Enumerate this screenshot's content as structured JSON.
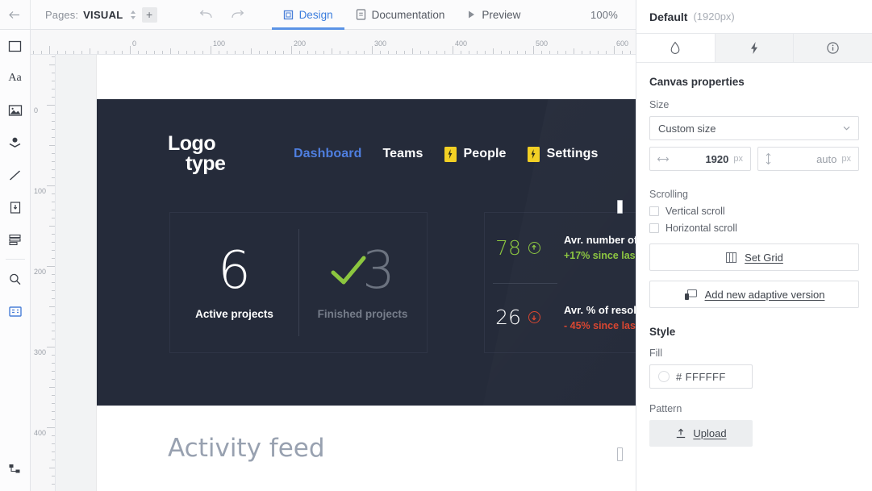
{
  "topbar": {
    "back_icon": "arrow-left-icon",
    "pages_label": "Pages:",
    "pages_value": "VISUAL",
    "add_page_label": "+",
    "undo_icon": "undo-icon",
    "redo_icon": "redo-icon",
    "tabs": [
      {
        "label": "Design",
        "icon": "design-frame-icon",
        "active": true
      },
      {
        "label": "Documentation",
        "icon": "document-icon",
        "active": false
      },
      {
        "label": "Preview",
        "icon": "play-icon",
        "active": false
      }
    ],
    "zoom_level": "100%"
  },
  "left_toolbar": {
    "items": [
      {
        "icon": "rectangle-icon",
        "name": "tool-rectangle"
      },
      {
        "icon": "text-icon",
        "name": "tool-text"
      },
      {
        "icon": "image-icon",
        "name": "tool-image"
      },
      {
        "icon": "layers-icon",
        "name": "tool-layers"
      },
      {
        "icon": "line-icon",
        "name": "tool-line"
      },
      {
        "icon": "button-icon",
        "name": "tool-button"
      },
      {
        "icon": "list-icon",
        "name": "tool-list"
      },
      {
        "icon": "search-icon",
        "name": "tool-search"
      },
      {
        "icon": "widgets-icon",
        "name": "tool-widgets",
        "active": true
      }
    ],
    "bottom_icon": "sitemap-icon"
  },
  "rulers": {
    "horizontal_ticks": [
      "0",
      "100",
      "200",
      "300",
      "400",
      "500",
      "600"
    ],
    "vertical_ticks": [
      "0",
      "100",
      "200",
      "300",
      "400"
    ]
  },
  "canvas": {
    "hero": {
      "logo_line1": "Logo",
      "logo_line2": "type",
      "nav": [
        {
          "label": "Dashboard",
          "active": true,
          "badge": false
        },
        {
          "label": "Teams",
          "active": false,
          "badge": false
        },
        {
          "label": "People",
          "active": false,
          "badge": true
        },
        {
          "label": "Settings",
          "active": false,
          "badge": true
        }
      ],
      "stats": [
        {
          "value": "6",
          "label": "Active projects",
          "muted": false,
          "check": false
        },
        {
          "value": "3",
          "label": "Finished projects",
          "muted": true,
          "check": true
        }
      ],
      "metrics": [
        {
          "value": "78",
          "direction": "up",
          "title": "Avr. number of",
          "delta": "+17% since las"
        },
        {
          "value": "26",
          "direction": "down",
          "title": "Avr. % of resol",
          "delta": "- 45% since las"
        }
      ]
    },
    "feed_title": "Activity feed"
  },
  "right_panel": {
    "title": "Default",
    "subtitle": "(1920px)",
    "tabs": [
      {
        "icon": "droplet-icon",
        "active": true
      },
      {
        "icon": "lightning-icon",
        "active": false
      },
      {
        "icon": "info-icon",
        "active": false
      }
    ],
    "canvas_properties_title": "Canvas properties",
    "size_label": "Size",
    "size_select_value": "Custom size",
    "width_value": "1920",
    "width_unit": "px",
    "height_value": "auto",
    "height_unit": "px",
    "scrolling_label": "Scrolling",
    "vertical_scroll_label": "Vertical scroll",
    "horizontal_scroll_label": "Horizontal scroll",
    "set_grid_label": "Set Grid",
    "add_adaptive_label": "Add new adaptive version",
    "style_label": "Style",
    "fill_label": "Fill",
    "fill_value": "# FFFFFF",
    "pattern_label": "Pattern",
    "upload_label": "Upload"
  },
  "colors": {
    "accent_blue": "#4a7fd8",
    "hero_dark": "#252b3a",
    "success_green": "#8cc63f",
    "danger_red": "#d9452f",
    "badge_yellow": "#f2d024"
  }
}
